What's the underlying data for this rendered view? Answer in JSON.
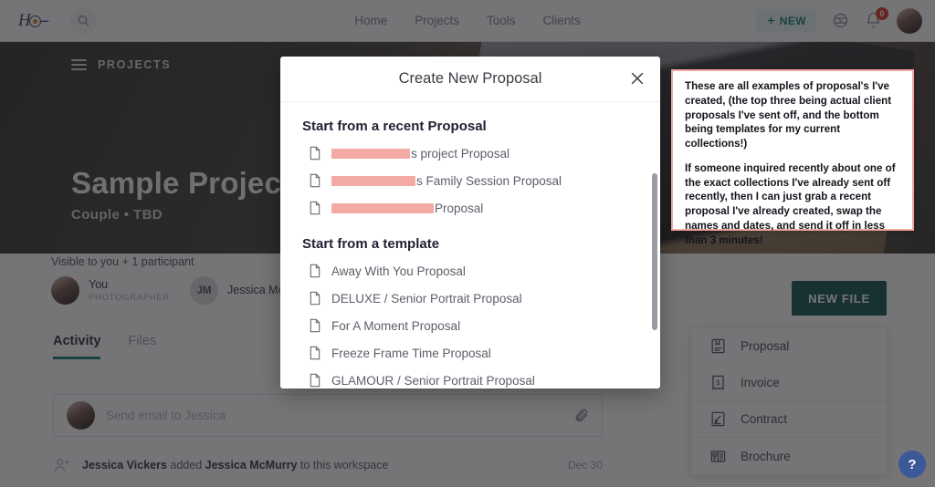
{
  "topbar": {
    "logo_alt": "HS camera logo",
    "search_icon": "search-icon",
    "nav": [
      {
        "label": "Home"
      },
      {
        "label": "Projects"
      },
      {
        "label": "Tools"
      },
      {
        "label": "Clients"
      }
    ],
    "new_button": "NEW",
    "money_icon": "dollar-globe-icon",
    "bell_icon": "bell-icon",
    "notification_count": "0",
    "avatar_alt": "user-avatar"
  },
  "hero": {
    "breadcrumb": "PROJECTS",
    "menu_icon": "hamburger-icon",
    "title": "Sample Project",
    "subtitle": "Couple • TBD"
  },
  "participants": {
    "visibility_label": "Visible to you + 1 participant",
    "people": [
      {
        "name": "You",
        "role": "PHOTOGRAPHER",
        "initials": ""
      },
      {
        "name": "Jessica McMurry",
        "role": "",
        "initials": "JM"
      }
    ]
  },
  "tabs": [
    {
      "label": "Activity",
      "active": true
    },
    {
      "label": "Files",
      "active": false
    }
  ],
  "composer": {
    "placeholder": "Send email to Jessica",
    "attach_icon": "paperclip-icon"
  },
  "activity": [
    {
      "icon": "add-user-icon",
      "actor": "Jessica Vickers",
      "action": " added ",
      "target": "Jessica McMurry",
      "suffix": " to this workspace",
      "date": "Dec 30"
    }
  ],
  "new_file": {
    "button_label": "NEW FILE",
    "menu": [
      {
        "label": "Proposal",
        "icon": "proposal-doc-icon"
      },
      {
        "label": "Invoice",
        "icon": "invoice-receipt-icon"
      },
      {
        "label": "Contract",
        "icon": "contract-sign-icon"
      },
      {
        "label": "Brochure",
        "icon": "brochure-icon"
      }
    ]
  },
  "help": {
    "label": "?"
  },
  "modal": {
    "title": "Create New Proposal",
    "close_icon": "close-icon",
    "recent_section_title": "Start from a recent Proposal",
    "recent": [
      {
        "redacted_width": 86,
        "suffix": "s project Proposal"
      },
      {
        "redacted_width": 92,
        "suffix": "s Family Session Proposal"
      },
      {
        "redacted_width": 112,
        "suffix": " Proposal"
      }
    ],
    "template_section_title": "Start from a template",
    "templates": [
      {
        "label": "Away With You Proposal"
      },
      {
        "label": "DELUXE / Senior Portrait Proposal"
      },
      {
        "label": "For A Moment Proposal"
      },
      {
        "label": "Freeze Frame Time Proposal"
      },
      {
        "label": "GLAMOUR / Senior Portrait Proposal"
      }
    ]
  },
  "annotation": {
    "paragraph1": "These are all examples of proposal's I've created, (the top three being actual client proposals I've sent off, and the bottom being templates for my current collections!)",
    "paragraph2": "If someone inquired recently about one of the exact collections I've already sent off recently, then I can just grab a recent proposal I've already created, swap the names and dates, and send it off in less than 3 minutes!"
  },
  "colors": {
    "accent_teal": "#0d4f4c",
    "badge_red": "#d93025",
    "redaction_pink": "#f4aaa4",
    "annotation_border": "#f0a79f",
    "help_blue": "#3b5998"
  }
}
